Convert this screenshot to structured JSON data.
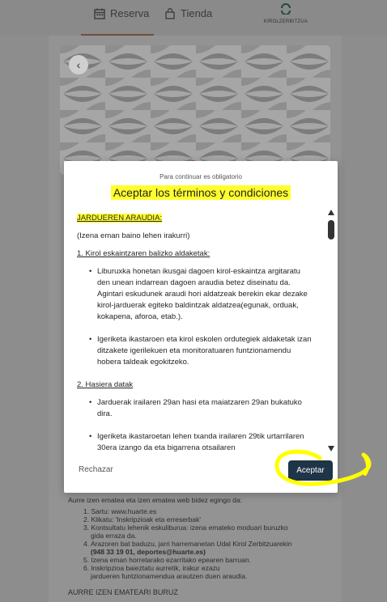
{
  "nav": {
    "tabs": [
      {
        "label": "Reserva",
        "icon": "calendar-icon"
      },
      {
        "label": "Tienda",
        "icon": "shopping-bag-icon"
      }
    ],
    "brand": "KIROLZERBITZUA"
  },
  "background": {
    "intro": "Aurre izen ematea eta izen ematea web bidez egingo da:",
    "steps": [
      "1. Sartu: www.huarte.es",
      "2. Klikatu: 'Inskripzioak eta erreserbak'",
      "3. Kontsultatu lehenik eskuliburua: izena emateko moduari buruzko",
      "gida erraza da.",
      "4. Arazoren bat baduzu, jarri harremanetan Udal Kirol Zerbitzuarekin",
      "(948 33 19 01, deportes@huarte.es)",
      "5. Izena eman horretarako ezarritako epearen barruan.",
      "6. Inskripzioa baieztatu aurretik, irakur ezazu",
      "jardueren funtzionamendua arautzen duen araudia."
    ],
    "section_heading": "AURRE IZEN EMATEARI BURUZ"
  },
  "modal": {
    "subtitle": "Para continuar es obligatorio",
    "title": "Aceptar los términos y condiciones",
    "content": {
      "heading": "JARDUEREN ARAUDIA:",
      "note": "(Izena eman baino lehen irakurri)",
      "section1": "1. Kirol eskaintzaren balizko aldaketak:",
      "section1_items": [
        "Liburuxka honetan ikusgai dagoen kirol-eskaintza argitaratu den unean indarrean dagoen araudia betez diseinatu da. Agintari eskudunek araudi hori aldatzeak berekin ekar dezake kirol-jarduerak egiteko baldintzak aldatzea(egunak, orduak, kokapena, aforoa, etab.).",
        "Igeriketa ikastaroen eta kirol eskolen ordutegiek aldaketak izan ditzakete igerilekuen eta monitoratuaren funtzionamendu hobera taldeak egokitzeko."
      ],
      "section2": "2. Hasiera datak",
      "section2_items": [
        "Jarduerak irailaren 29an hasi eta maiatzaren 29an bukatuko dira.",
        "Igeriketa ikastaroetan lehen txanda irailaren 29tik urtarrilaren 30era izango da eta bigarrena otsailaren"
      ]
    },
    "reject_label": "Rechazar",
    "accept_label": "Aceptar"
  },
  "colors": {
    "highlight": "#ffff2d",
    "accept_button": "#1e3447",
    "annotation": "#ffff00"
  }
}
